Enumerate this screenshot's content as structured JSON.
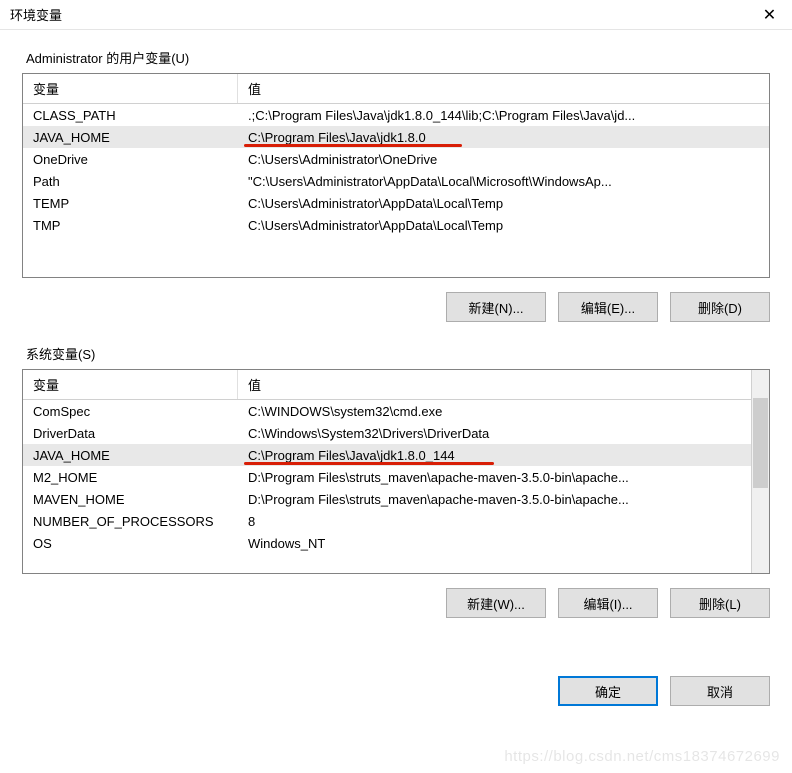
{
  "window": {
    "title": "环境变量"
  },
  "user_vars": {
    "label": "Administrator 的用户变量(U)",
    "headers": {
      "var": "变量",
      "val": "值"
    },
    "rows": [
      {
        "var": "CLASS_PATH",
        "val": ".;C:\\Program Files\\Java\\jdk1.8.0_144\\lib;C:\\Program Files\\Java\\jd..."
      },
      {
        "var": "JAVA_HOME",
        "val": "C:\\Program Files\\Java\\jdk1.8.0"
      },
      {
        "var": "OneDrive",
        "val": "C:\\Users\\Administrator\\OneDrive"
      },
      {
        "var": "Path",
        "val": "\"C:\\Users\\Administrator\\AppData\\Local\\Microsoft\\WindowsAp..."
      },
      {
        "var": "TEMP",
        "val": "C:\\Users\\Administrator\\AppData\\Local\\Temp"
      },
      {
        "var": "TMP",
        "val": "C:\\Users\\Administrator\\AppData\\Local\\Temp"
      }
    ],
    "buttons": {
      "new": "新建(N)...",
      "edit": "编辑(E)...",
      "del": "删除(D)"
    }
  },
  "sys_vars": {
    "label": "系统变量(S)",
    "headers": {
      "var": "变量",
      "val": "值"
    },
    "rows": [
      {
        "var": "ComSpec",
        "val": "C:\\WINDOWS\\system32\\cmd.exe"
      },
      {
        "var": "DriverData",
        "val": "C:\\Windows\\System32\\Drivers\\DriverData"
      },
      {
        "var": "JAVA_HOME",
        "val": "C:\\Program Files\\Java\\jdk1.8.0_144"
      },
      {
        "var": "M2_HOME",
        "val": "D:\\Program Files\\struts_maven\\apache-maven-3.5.0-bin\\apache..."
      },
      {
        "var": "MAVEN_HOME",
        "val": "D:\\Program Files\\struts_maven\\apache-maven-3.5.0-bin\\apache..."
      },
      {
        "var": "NUMBER_OF_PROCESSORS",
        "val": "8"
      },
      {
        "var": "OS",
        "val": "Windows_NT"
      }
    ],
    "buttons": {
      "new": "新建(W)...",
      "edit": "编辑(I)...",
      "del": "删除(L)"
    }
  },
  "footer": {
    "ok": "确定",
    "cancel": "取消"
  },
  "watermark": "https://blog.csdn.net/cms18374672699"
}
